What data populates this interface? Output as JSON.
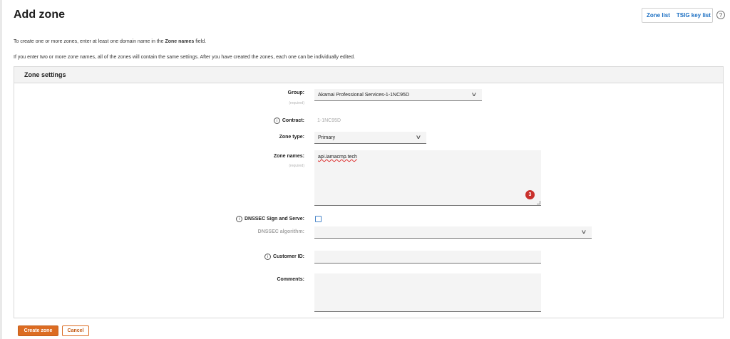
{
  "page": {
    "title": "Add zone"
  },
  "top_links": {
    "zone_list": "Zone list",
    "tsig_key_list": "TSIG key list",
    "help_glyph": "?"
  },
  "intro": {
    "line1_prefix": "To create one or more zones, enter at least one domain name in the ",
    "line1_bold": "Zone names",
    "line1_suffix": " field.",
    "line2": "If you enter two or more zone names, all of the zones will contain the same settings. After you have created the zones, each one can be individually edited."
  },
  "panel": {
    "title": "Zone settings"
  },
  "fields": {
    "group": {
      "label": "Group:",
      "required": "(required)",
      "value": "Akamai Professional Services-1-1NC95D"
    },
    "contract": {
      "label": "Contract:",
      "value": "1-1NC95D"
    },
    "zone_type": {
      "label": "Zone type:",
      "value": "Primary"
    },
    "zone_names": {
      "label": "Zone names:",
      "required": "(required)",
      "value": "api.iamacmp.tech",
      "badge_count": "3"
    },
    "dnssec": {
      "label": "DNSSEC Sign and Serve:",
      "checked": false
    },
    "dnssec_algorithm": {
      "label": "DNSSEC algorithm:",
      "value": ""
    },
    "customer_id": {
      "label": "Customer ID:",
      "value": ""
    },
    "comments": {
      "label": "Comments:",
      "value": ""
    }
  },
  "icons": {
    "info": "i",
    "chevron": "∨"
  },
  "buttons": {
    "create": "Create zone",
    "cancel": "Cancel"
  }
}
